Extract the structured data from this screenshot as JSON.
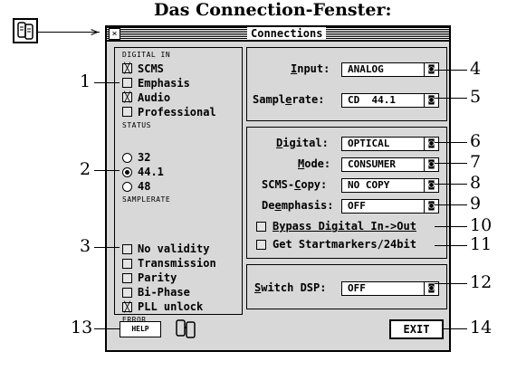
{
  "caption": "Das Connection-Fenster:",
  "window": {
    "title": "Connections"
  },
  "digital_in": {
    "heading": "DIGITAL IN",
    "items": [
      {
        "label": "SCMS",
        "checked": true
      },
      {
        "label": "Emphasis",
        "checked": false
      },
      {
        "label": "Audio",
        "checked": true
      },
      {
        "label": "Professional",
        "checked": false
      }
    ],
    "footer": "STATUS"
  },
  "samplerate_radio": {
    "options": [
      "32",
      "44.1",
      "48"
    ],
    "selected": "44.1",
    "footer": "SAMPLERATE"
  },
  "error": {
    "items": [
      {
        "label": "No validity",
        "checked": false
      },
      {
        "label": "Transmission",
        "checked": false
      },
      {
        "label": "Parity",
        "checked": false
      },
      {
        "label": "Bi-Phase",
        "checked": false
      },
      {
        "label": "PLL unlock",
        "checked": true
      }
    ],
    "footer": "ERROR"
  },
  "input_panel": {
    "input_label": "Input:",
    "input_value": "ANALOG",
    "samplerate_label": "Samplerate:",
    "samplerate_value": "CD  44.1"
  },
  "digital_panel": {
    "digital_label": "Digital:",
    "digital_value": "OPTICAL",
    "mode_label": "Mode:",
    "mode_value": "CONSUMER",
    "scms_label": "SCMS-Copy:",
    "scms_value": "NO COPY",
    "deemph_label": "Deemphasis:",
    "deemph_value": "OFF",
    "bypass_label": "Bypass Digital In->Out",
    "bypass_checked": false,
    "startmarkers_label": "Get Startmarkers/24bit",
    "startmarkers_checked": false
  },
  "dsp_panel": {
    "label": "Switch DSP:",
    "value": "OFF"
  },
  "buttons": {
    "help": "HELP",
    "exit": "EXIT"
  },
  "callouts": [
    "1",
    "2",
    "3",
    "4",
    "5",
    "6",
    "7",
    "8",
    "9",
    "10",
    "11",
    "12",
    "13",
    "14"
  ],
  "icons": {
    "app_icon": "connection-icon",
    "dropdown": "popup-arrow-icon"
  }
}
